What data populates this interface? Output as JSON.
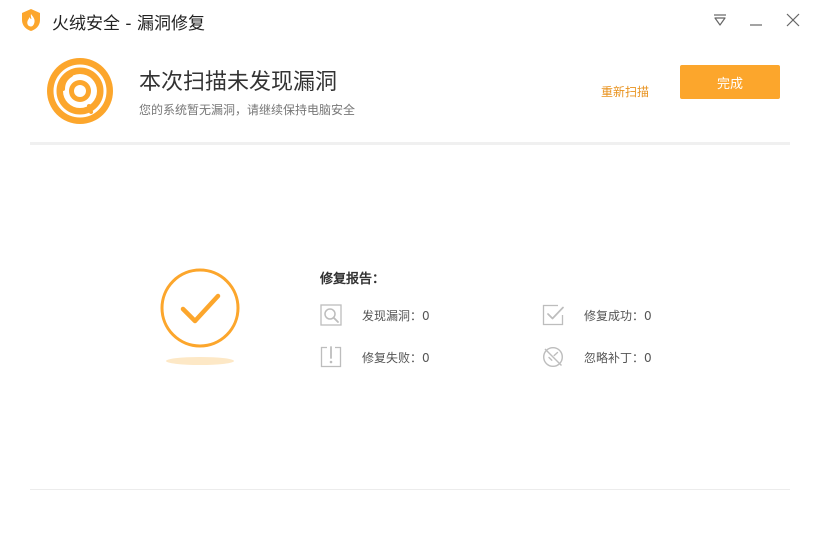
{
  "window": {
    "title": "火绒安全 - 漏洞修复",
    "controls": {
      "menu_icon": "dropdown-triangle-icon",
      "minimize_icon": "minimize-icon",
      "close_icon": "close-icon"
    }
  },
  "header": {
    "result_icon": "radar-scan-icon",
    "headline": "本次扫描未发现漏洞",
    "subline": "您的系统暂无漏洞，请继续保持电脑安全",
    "rescan_label": "重新扫描",
    "done_label": "完成"
  },
  "report": {
    "status_icon": "check-circle-icon",
    "title": "修复报告：",
    "stats": {
      "found": {
        "label": "发现漏洞：0",
        "icon": "magnifier-icon"
      },
      "fixed": {
        "label": "修复成功：0",
        "icon": "checkbox-tick-icon"
      },
      "failed": {
        "label": "修复失败：0",
        "icon": "alert-bracket-icon"
      },
      "ignored": {
        "label": "忽略补丁：0",
        "icon": "ignore-slash-icon"
      }
    }
  },
  "colors": {
    "accent": "#fca62c",
    "accent_text": "#e8921e",
    "muted_icon": "#bdbdbd"
  }
}
